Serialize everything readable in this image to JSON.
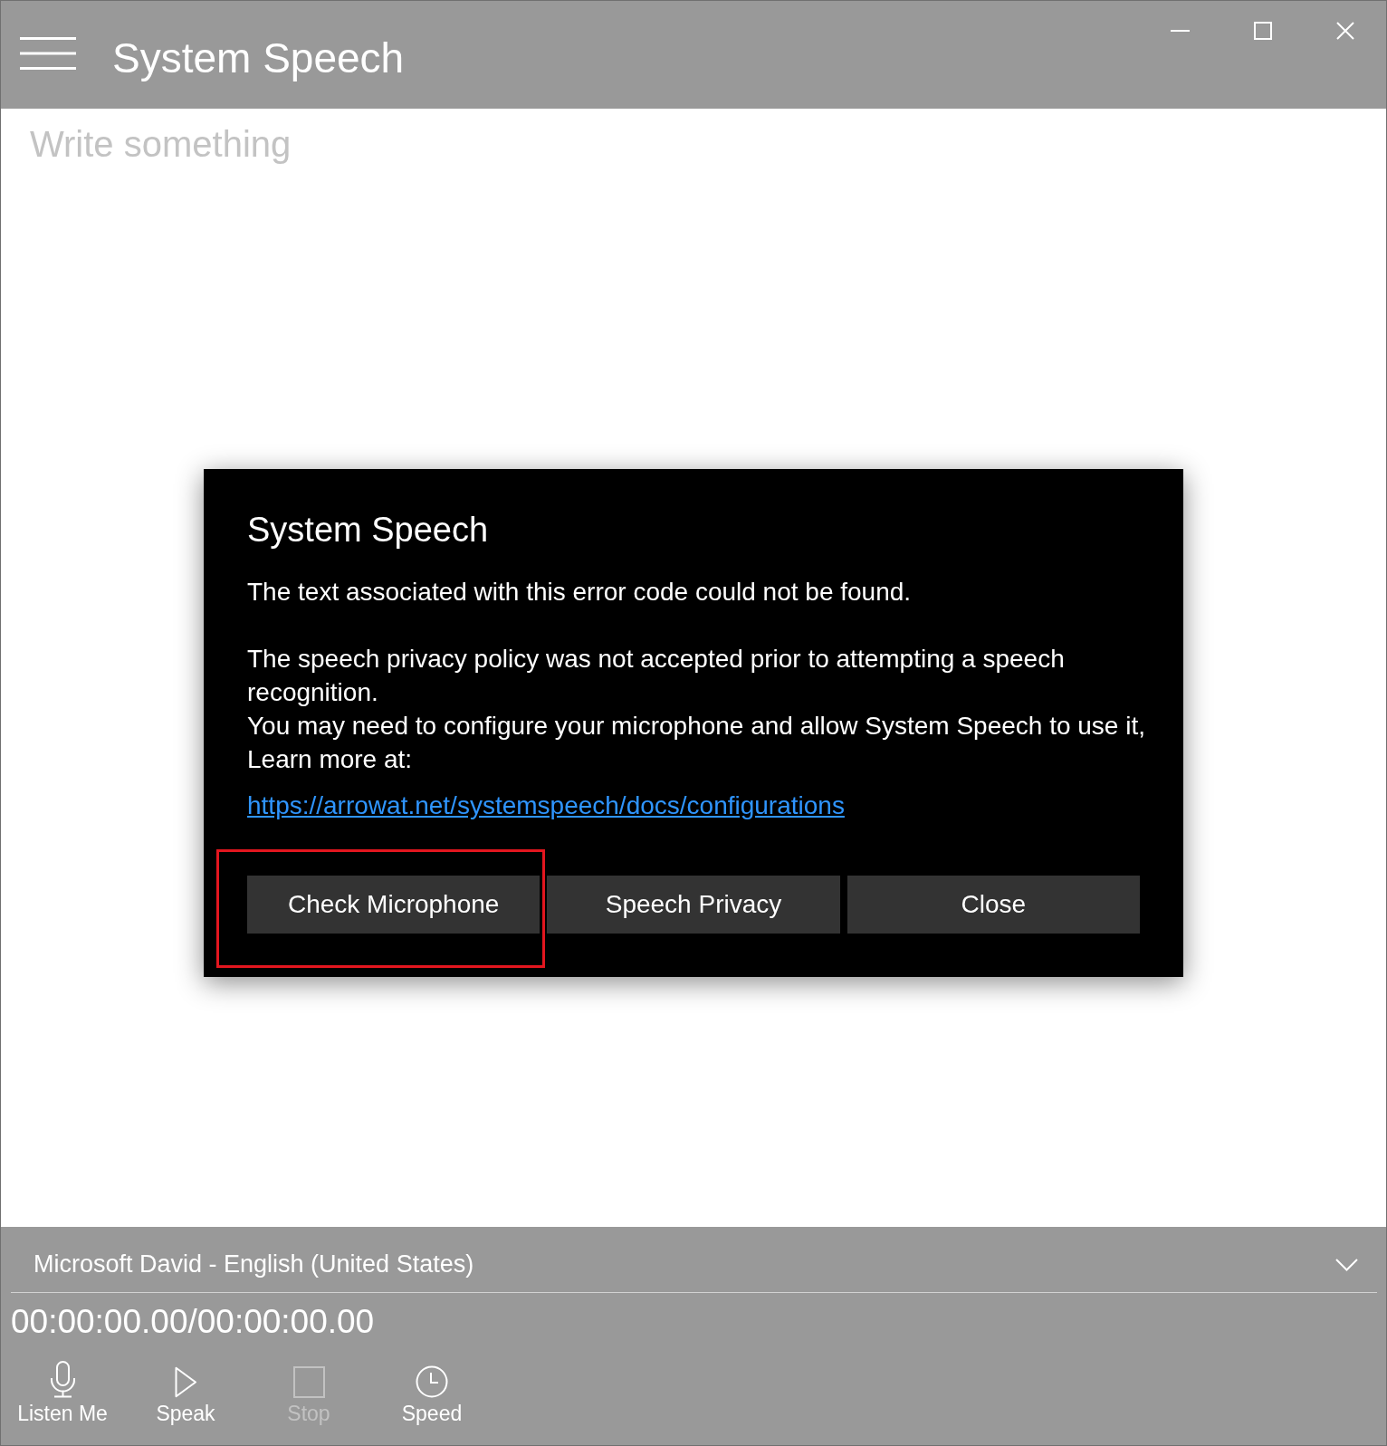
{
  "window": {
    "title": "System Speech"
  },
  "editor": {
    "placeholder": "Write something"
  },
  "dialog": {
    "title": "System Speech",
    "paragraphs": [
      "The text associated with this error code could not be found.",
      "The speech privacy policy was not accepted prior to attempting a speech recognition.\nYou may need to configure your microphone and allow System Speech to use it, Learn more at:"
    ],
    "link": "https://arrowat.net/systemspeech/docs/configurations",
    "buttons": [
      {
        "label": "Check Microphone",
        "highlighted": true
      },
      {
        "label": "Speech Privacy",
        "highlighted": false
      },
      {
        "label": "Close",
        "highlighted": false
      }
    ]
  },
  "voice_select": {
    "value": "Microsoft David - English (United States)"
  },
  "playback": {
    "time": "00:00:00.00/00:00:00.00"
  },
  "toolbar": {
    "buttons": [
      {
        "label": "Listen Me",
        "disabled": false
      },
      {
        "label": "Speak",
        "disabled": false
      },
      {
        "label": "Stop",
        "disabled": true
      },
      {
        "label": "Speed",
        "disabled": false
      }
    ]
  }
}
